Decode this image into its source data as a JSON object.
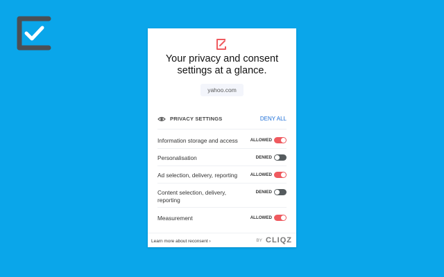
{
  "popup": {
    "title_line1": "Your privacy and consent",
    "title_line2": "settings at a glance.",
    "domain": "yahoo.com",
    "section_title": "PRIVACY SETTINGS",
    "deny_all_label": "DENY ALL",
    "rows": [
      {
        "label": "Information storage and access",
        "status": "ALLOWED",
        "state": "on"
      },
      {
        "label": "Personalisation",
        "status": "DENIED",
        "state": "off"
      },
      {
        "label": "Ad selection, delivery, reporting",
        "status": "ALLOWED",
        "state": "on"
      },
      {
        "label_line1": "Content selection, delivery,",
        "label_line2": "reporting",
        "status": "DENIED",
        "state": "off"
      },
      {
        "label": "Measurement",
        "status": "ALLOWED",
        "state": "on"
      }
    ],
    "footer_link": "Learn more about reconsent ›",
    "by_label": "BY",
    "brand": "CLIQZ"
  },
  "colors": {
    "background": "#0aa6ea",
    "accent_red": "#ef5a5f",
    "toggle_off": "#555b5e",
    "link_blue": "#1d6fd8",
    "logo_dark": "#4a4f55"
  },
  "icons": {
    "logo": "checkmark-logo-icon",
    "header": "edit-logo-icon",
    "section": "eye-icon"
  }
}
